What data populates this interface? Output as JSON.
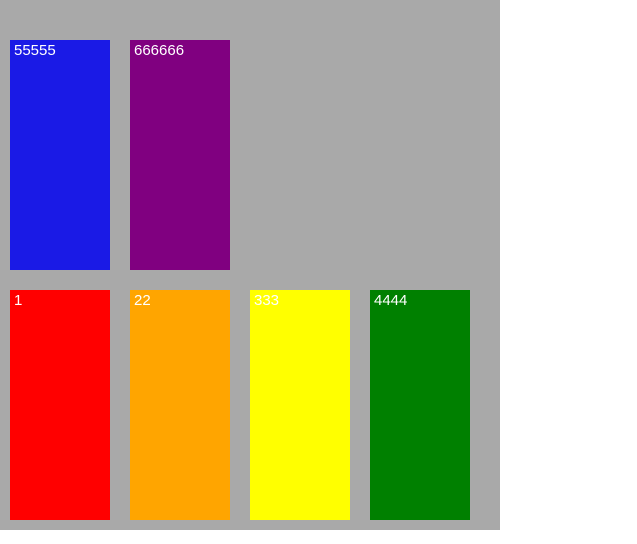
{
  "boxes": [
    {
      "label": "1",
      "color": "#ff0000"
    },
    {
      "label": "22",
      "color": "#ffa500"
    },
    {
      "label": "333",
      "color": "#ffff00"
    },
    {
      "label": "4444",
      "color": "#008000"
    },
    {
      "label": "55555",
      "color": "#1a1ae6"
    },
    {
      "label": "666666",
      "color": "#800080"
    }
  ],
  "container_bg": "#a9a9a9"
}
